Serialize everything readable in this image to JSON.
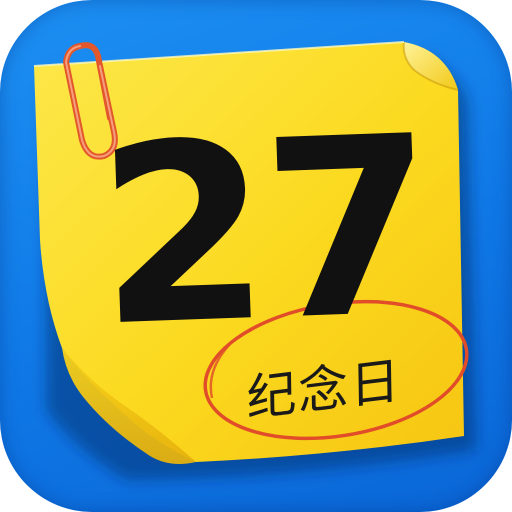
{
  "icon": {
    "date_number": "27",
    "label": "纪念日",
    "colors": {
      "background": "#1283ee",
      "note": "#fce02b",
      "note_shadow": "#e8b712",
      "clip": "#e2582c",
      "circle": "#e04d28",
      "text": "#111111"
    },
    "icons": {
      "sticky_note": "sticky-note-icon",
      "paperclip": "paperclip-icon"
    }
  }
}
